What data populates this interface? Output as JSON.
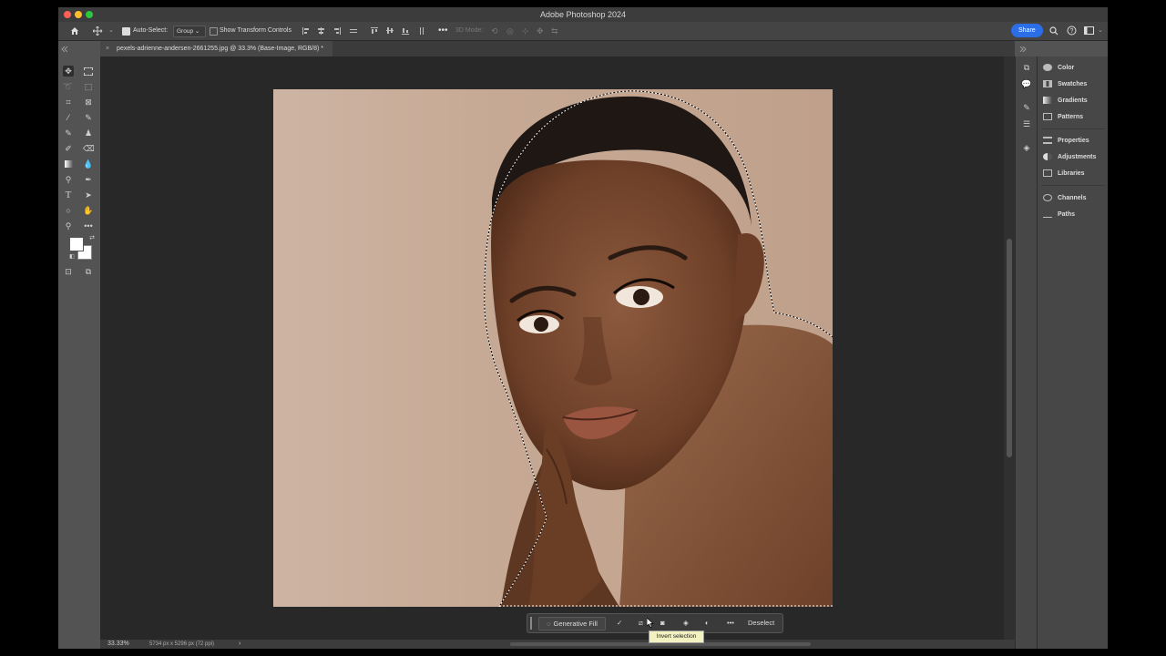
{
  "app": {
    "title": "Adobe Photoshop 2024"
  },
  "options_bar": {
    "auto_select_label": "Auto-Select:",
    "auto_select_target": "Group",
    "show_transform_label": "Show Transform Controls",
    "mode_3d_label": "3D Mode:",
    "share_label": "Share"
  },
  "document": {
    "tab_title": "pexels-adrienne-andersen-2661255.jpg @ 33.3% (Base-Image, RGB/8) *",
    "tab_close": "×"
  },
  "status": {
    "zoom": "33.33%",
    "dimensions": "5734 px x 5296 px (72 ppi)",
    "arrow": "›"
  },
  "contextual_task_bar": {
    "generative_fill_label": "Generative Fill",
    "deselect_label": "Deselect",
    "tooltip": "Invert selection"
  },
  "panels": {
    "group1": [
      "Color",
      "Swatches",
      "Gradients",
      "Patterns"
    ],
    "group2": [
      "Properties",
      "Adjustments",
      "Libraries"
    ],
    "group3": [
      "Channels",
      "Paths"
    ]
  },
  "colors": {
    "accent": "#2b6ee8",
    "canvas_bg": "#282828",
    "backdrop": "#c9ae9b",
    "skin": "#7a4a33",
    "hair": "#1e1714"
  }
}
